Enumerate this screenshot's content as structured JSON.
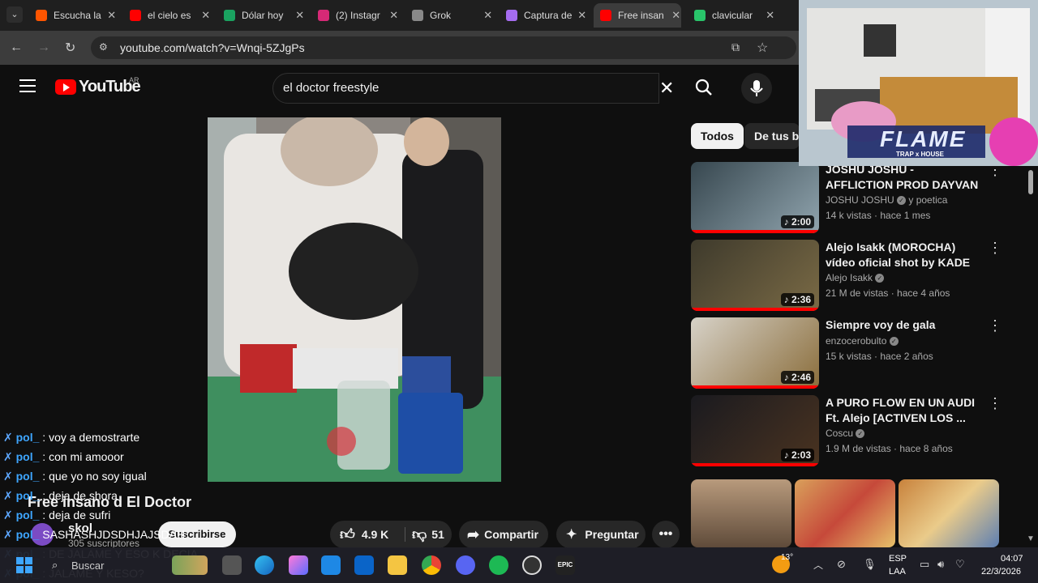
{
  "tabs": [
    {
      "title": "Escucha la",
      "color": "#ff5500"
    },
    {
      "title": "el cielo es",
      "color": "#ff0000"
    },
    {
      "title": "Dólar hoy",
      "color": "#1aa260"
    },
    {
      "title": "(2) Instagr",
      "color": "#d62976"
    },
    {
      "title": "Grok",
      "color": "#888888"
    },
    {
      "title": "Captura de",
      "color": "#a56cf0"
    },
    {
      "title": "Free insan",
      "color": "#ff0000"
    },
    {
      "title": "clavicular",
      "color": "#29c46a"
    }
  ],
  "address": {
    "url": "youtube.com/watch?v=Wnqi-5ZJgPs"
  },
  "youtube": {
    "logo": "YouTube",
    "region": "AR",
    "search_value": "el doctor freestyle"
  },
  "chips": [
    "Todos",
    "De tus b"
  ],
  "recommendations": [
    {
      "title": "JOSHU JOSHU - AFFLICTION PROD DAYVAN",
      "channel": "JOSHU JOSHU",
      "channel_suffix": "y poetica",
      "meta": "14 k vistas · hace 1 mes",
      "duration": "2:00",
      "colors": [
        "#37474f",
        "#90a4ae"
      ]
    },
    {
      "title": "Alejo Isakk (MOROCHA) vídeo oficial shot by KADE",
      "channel": "Alejo Isakk",
      "channel_suffix": "",
      "meta": "21 M de vistas · hace 4 años",
      "duration": "2:36",
      "colors": [
        "#3e3a2c",
        "#7a6a45"
      ]
    },
    {
      "title": "Siempre voy de gala",
      "channel": "enzocerobulto",
      "channel_suffix": "",
      "meta": "15 k vistas · hace 2 años",
      "duration": "2:46",
      "colors": [
        "#d7d2c8",
        "#8a6d3b"
      ]
    },
    {
      "title": "A PURO FLOW EN UN AUDI Ft. Alejo [ACTIVEN LOS ...",
      "channel": "Coscu",
      "channel_suffix": "",
      "meta": "1.9 M de vistas · hace 8 años",
      "duration": "2:03",
      "colors": [
        "#1a1a1f",
        "#4a3320"
      ]
    }
  ],
  "video": {
    "title": "Free insano d El Doctor",
    "channel": "skol",
    "subscribers": "305 suscriptores",
    "subscribe_label": "Suscribirse"
  },
  "actions": {
    "likes": "4.9 K",
    "dislikes": "51",
    "share": "Compartir",
    "ask": "Preguntar"
  },
  "chat": [
    {
      "user": "pol_",
      "text": ": voy a demostrarte"
    },
    {
      "user": "pol_",
      "text": ": con mi amooor"
    },
    {
      "user": "pol_",
      "text": ": que yo no soy igual"
    },
    {
      "user": "pol_",
      "text": ": deja de shora"
    },
    {
      "user": "pol_",
      "text": ": deja de sufri"
    },
    {
      "user": "pol_",
      "text": "SASHASHJDSDHJAJSDAH"
    },
    {
      "user": "pol_",
      "text": ": DE JALAME Y ESO K DECIA"
    },
    {
      "user": "pol_",
      "text": ": JALAME Y KESO?"
    }
  ],
  "webcam": {
    "overlay_text": "FLAME",
    "overlay_sub": "TRAP x HOUSE"
  },
  "taskbar": {
    "search_placeholder": "Buscar",
    "weather": "13°",
    "lang_top": "ESP",
    "lang_bottom": "LAA",
    "time": "04:07",
    "date": "22/3/2026"
  }
}
